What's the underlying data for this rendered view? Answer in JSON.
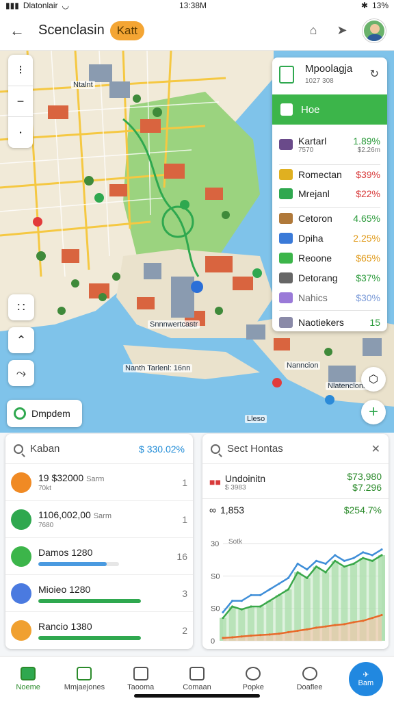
{
  "status": {
    "carrier": "Dlatonlair",
    "time": "13:38M",
    "battery": "13%"
  },
  "header": {
    "title": "Scenclasin",
    "badge": "Katt"
  },
  "map": {
    "labels": [
      "Ntalnt",
      "Snnnwertcastr",
      "Nanth Tarlenl: 16nn",
      "Nanncion",
      "Nlatenclonn",
      "Lleso"
    ],
    "pill_label": "Dmpdem",
    "colors": {
      "water": "#7fc3ea",
      "land": "#f1ead8",
      "park": "#8fd17a",
      "roof": "#d9643f",
      "road": "#f5c842"
    }
  },
  "legend": {
    "title": "Mpoolagja",
    "subtitle": "1027 308",
    "bar_label": "Hoe",
    "top_row": {
      "name": "Kartarl",
      "sub": "7570",
      "value": "1.89%",
      "value2": "$2.26m"
    },
    "rows1": [
      {
        "name": "Romectan",
        "value": "$39%",
        "color": "#d83a3a"
      },
      {
        "name": "Mrejanl",
        "value": "$22%",
        "color": "#d83a3a"
      }
    ],
    "rows2": [
      {
        "name": "Cetoron",
        "value": "4.65%",
        "color": "#2a9a3a"
      },
      {
        "name": "Dpiha",
        "value": "2.25%",
        "color": "#e09a1a"
      },
      {
        "name": "Reoone",
        "value": "$65%",
        "color": "#e09a1a"
      },
      {
        "name": "Detorang",
        "value": "$37%",
        "color": "#2a9a3a"
      },
      {
        "name": "Nahics",
        "value": "$30%",
        "color": "#7a9ad8"
      }
    ],
    "footer": {
      "name": "Naotiekers",
      "value": "15",
      "color": "#2a9a3a"
    }
  },
  "card1": {
    "search": "Kaban",
    "amount": "$ 330.02%",
    "items": [
      {
        "title": "19 $32000",
        "suffix": "Sarm",
        "sub": "70kt",
        "num": "1",
        "icon_color": "#f08a24"
      },
      {
        "title": "1106,002,00",
        "suffix": "Sarm",
        "sub": "7680",
        "num": "1",
        "icon_color": "#2fa84f"
      },
      {
        "title": "Damos 1280",
        "num": "16",
        "icon_color": "#3cb54a",
        "progress": 0.85,
        "bar_color": "#4a9ae0"
      },
      {
        "title": "Mioieo 1280",
        "num": "3",
        "icon_color": "#4a7ae0",
        "progress": 1.0,
        "bar_color": "#2fa84f"
      },
      {
        "title": "Rancio 1380",
        "num": "2",
        "icon_color": "#f0a030",
        "progress": 1.0,
        "bar_color": "#2fa84f"
      }
    ]
  },
  "card2": {
    "search": "Sect Hontas",
    "stat1": {
      "title": "Undoinitn",
      "sub": "$ 3983",
      "value": "$73,980",
      "value2": "$7.296"
    },
    "stat2": {
      "title": "1,853",
      "value": "$254.7%"
    },
    "chart_data": {
      "type": "area",
      "title": "Sotk",
      "ytick_labels": [
        "30",
        "S0",
        "S0",
        "0"
      ],
      "series": [
        {
          "values": [
            10,
            14,
            14,
            16,
            16,
            18,
            20,
            22,
            27,
            25,
            28,
            27,
            30,
            28,
            29,
            31,
            30,
            32
          ],
          "color": "#3f8ed8"
        },
        {
          "values": [
            8,
            12,
            11,
            12,
            12,
            14,
            16,
            18,
            24,
            22,
            26,
            24,
            28,
            26,
            27,
            29,
            28,
            30
          ],
          "color": "#3aa84a"
        },
        {
          "values": [
            1,
            1.2,
            1.5,
            1.8,
            2,
            2.2,
            2.5,
            3,
            3.5,
            4,
            4.6,
            5,
            5.5,
            5.8,
            6.5,
            7,
            8,
            9
          ],
          "color": "#e86a2a"
        }
      ],
      "ylim": [
        0,
        36
      ]
    }
  },
  "tabs": [
    {
      "label": "Noeme",
      "active": true
    },
    {
      "label": "Mmjaejones",
      "active": false
    },
    {
      "label": "Taooma",
      "active": false
    },
    {
      "label": "Comaan",
      "active": false
    },
    {
      "label": "Popke",
      "active": false
    },
    {
      "label": "Doaflee",
      "active": false
    },
    {
      "label": "Bam",
      "active": false
    }
  ]
}
